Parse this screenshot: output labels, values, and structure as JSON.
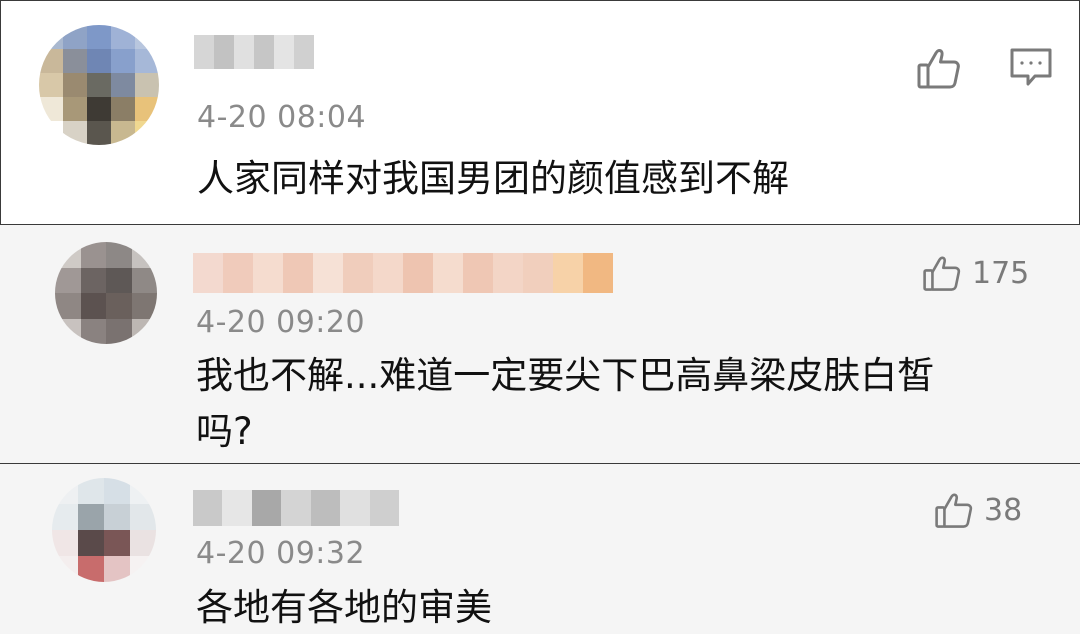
{
  "comments": [
    {
      "avatar": "pixelated-avatar",
      "timestamp": "4-20 08:04",
      "text": "人家同样对我国男团的颜值感到不解",
      "actions": {
        "like_icon": "thumbs-up-icon",
        "reply_icon": "comment-icon"
      }
    },
    {
      "avatar": "pixelated-avatar",
      "timestamp": "4-20 09:20",
      "text": "我也不解...难道一定要尖下巴高鼻梁皮肤白皙\n吗?",
      "likes": "175"
    },
    {
      "avatar": "pixelated-avatar",
      "timestamp": "4-20 09:32",
      "text": "各地有各地的审美",
      "likes": "38"
    }
  ]
}
